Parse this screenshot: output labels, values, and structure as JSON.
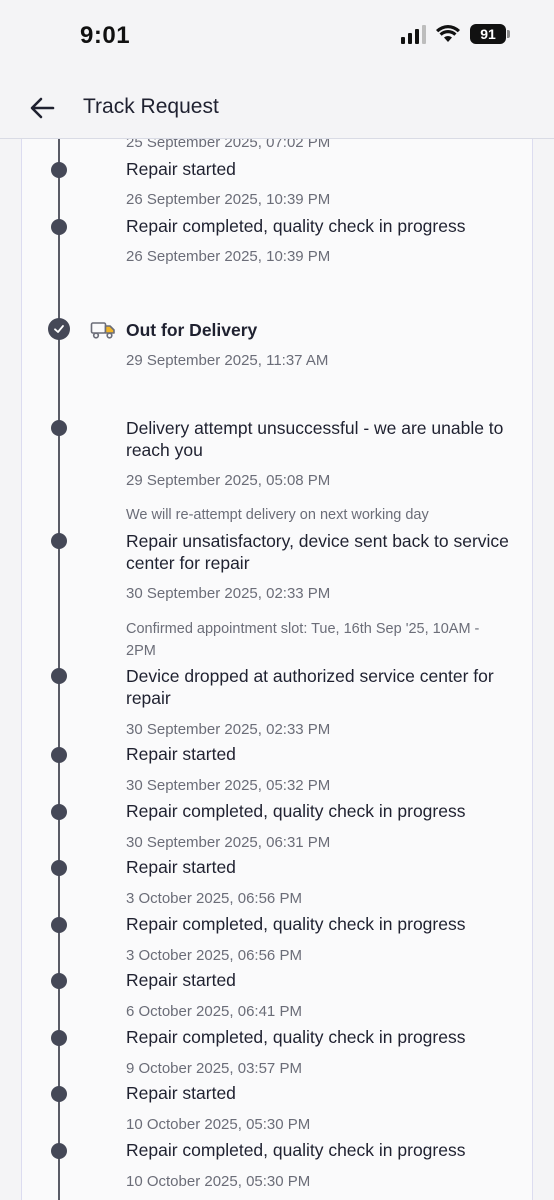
{
  "status_bar": {
    "time": "9:01",
    "battery": "91"
  },
  "header": {
    "title": "Track Request"
  },
  "timeline": {
    "top_date": "25 September 2025, 07:02 PM",
    "events": [
      {
        "title": "Repair started",
        "date": "26 September 2025, 10:39 PM"
      },
      {
        "title": "Repair completed, quality check in progress",
        "date": "26 September 2025, 10:39 PM"
      },
      {
        "title": "Out for Delivery",
        "date": "29 September 2025, 11:37 AM"
      },
      {
        "title": "Delivery attempt unsuccessful - we are unable to reach you",
        "date": "29 September 2025, 05:08 PM",
        "note": "We will re-attempt delivery on next working day"
      },
      {
        "title": "Repair unsatisfactory, device sent back to service center for repair",
        "date": "30 September 2025, 02:33 PM",
        "note": "Confirmed appointment slot: Tue, 16th Sep '25, 10AM - 2PM"
      },
      {
        "title": "Device dropped at authorized service center for repair",
        "date": "30 September 2025, 02:33 PM"
      },
      {
        "title": "Repair started",
        "date": "30 September 2025, 05:32 PM"
      },
      {
        "title": "Repair completed, quality check in progress",
        "date": "30 September 2025, 06:31 PM"
      },
      {
        "title": "Repair started",
        "date": "3 October 2025, 06:56 PM"
      },
      {
        "title": "Repair completed, quality check in progress",
        "date": "3 October 2025, 06:56 PM"
      },
      {
        "title": "Repair started",
        "date": "6 October 2025, 06:41 PM"
      },
      {
        "title": "Repair completed, quality check in progress",
        "date": "9 October 2025, 03:57 PM"
      },
      {
        "title": "Repair started",
        "date": "10 October 2025, 05:30 PM"
      },
      {
        "title": "Repair completed, quality check in progress",
        "date": "10 October 2025, 05:30 PM"
      }
    ]
  },
  "icons": {
    "back": "arrow-left-icon",
    "truck": "truck-icon",
    "check": "check-circle-icon"
  },
  "colors": {
    "dot": "#454857",
    "line": "#595b66",
    "truck_accent": "#f0b429"
  }
}
